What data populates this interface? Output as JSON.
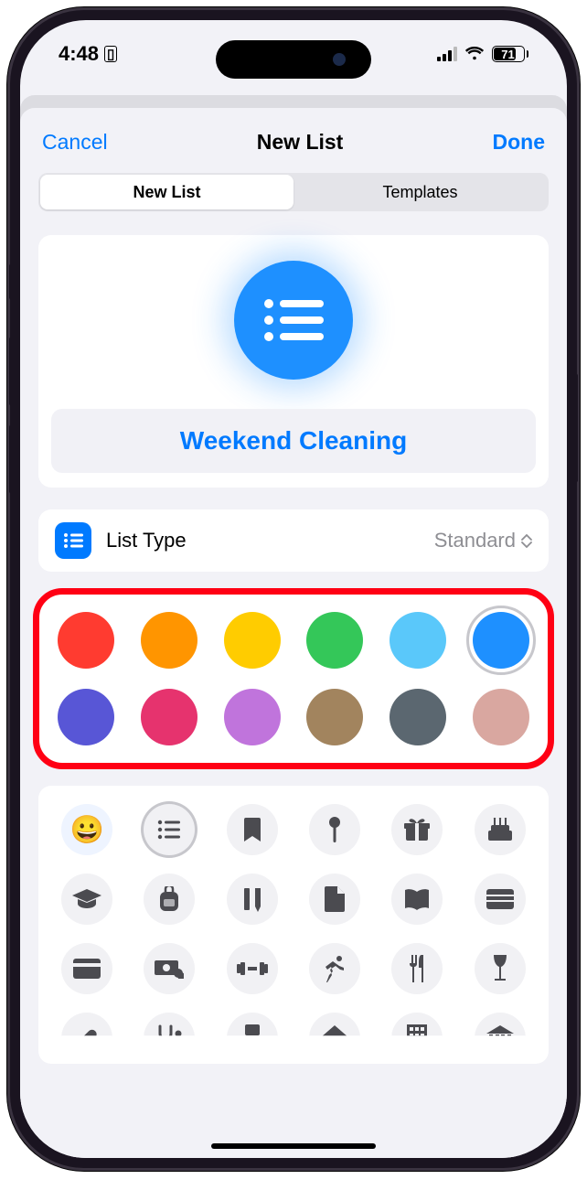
{
  "status": {
    "time": "4:48",
    "battery_pct": "71"
  },
  "nav": {
    "cancel": "Cancel",
    "title": "New List",
    "done": "Done"
  },
  "tabs": {
    "a": "New List",
    "b": "Templates"
  },
  "list": {
    "name": "Weekend Cleaning",
    "type_label": "List Type",
    "type_value": "Standard",
    "selected_color": "#1e90ff"
  },
  "colors": [
    "#ff3b30",
    "#ff9500",
    "#ffcc00",
    "#34c759",
    "#5ac8fa",
    "#1e90ff",
    "#5856d6",
    "#e6336e",
    "#c074dc",
    "#a2845e",
    "#5b6770",
    "#d9a7a0"
  ],
  "icons": [
    "smiley-icon",
    "list-icon",
    "bookmark-icon",
    "pin-icon",
    "gift-icon",
    "cake-icon",
    "graduation-icon",
    "backpack-icon",
    "ruler-pencil-icon",
    "document-icon",
    "book-icon",
    "wallet-icon",
    "credit-card-icon",
    "money-icon",
    "dumbbell-icon",
    "running-icon",
    "fork-knife-icon",
    "wine-icon",
    "pill-icon",
    "stethoscope-icon",
    "chair-icon",
    "house-icon",
    "building-icon",
    "bank-icon"
  ]
}
